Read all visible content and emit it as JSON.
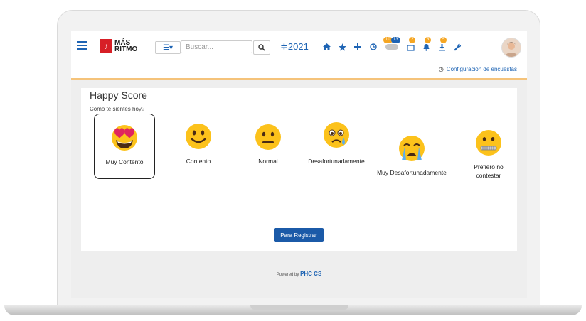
{
  "logo": {
    "line1": "MÁS",
    "line2": "RITMO"
  },
  "search": {
    "placeholder": "Buscar..."
  },
  "header": {
    "year": "≑2021",
    "list_label": "☰▾"
  },
  "badges": {
    "b1": "10",
    "b2": "13",
    "b3": "2",
    "b4": "3",
    "b5": "5"
  },
  "subbar": {
    "config_label": "Configuración de encuestas"
  },
  "card": {
    "title": "Happy Score",
    "question": "Cómo te sientes hoy?",
    "options": [
      {
        "label": "Muy Contento",
        "icon": "heart-eyes-emoji-icon",
        "selected": true
      },
      {
        "label": "Contento",
        "icon": "smiling-emoji-icon"
      },
      {
        "label": "Normal",
        "icon": "neutral-emoji-icon"
      },
      {
        "label": "Desafortunadamente",
        "icon": "sad-tear-emoji-icon"
      },
      {
        "label": "Muy Desafortunadamente",
        "icon": "crying-emoji-icon"
      },
      {
        "label": "Prefiero no contestar",
        "icon": "zipper-mouth-emoji-icon"
      }
    ],
    "register_label": "Para Registrar"
  },
  "footer": {
    "prefix": "Powered by",
    "brand": "PHC CS"
  },
  "colors": {
    "primary": "#1e64b4",
    "accent": "#f5a623",
    "button": "#1b5aa8",
    "logo_red": "#d71f26",
    "emoji_yellow": "#fcc21b"
  }
}
